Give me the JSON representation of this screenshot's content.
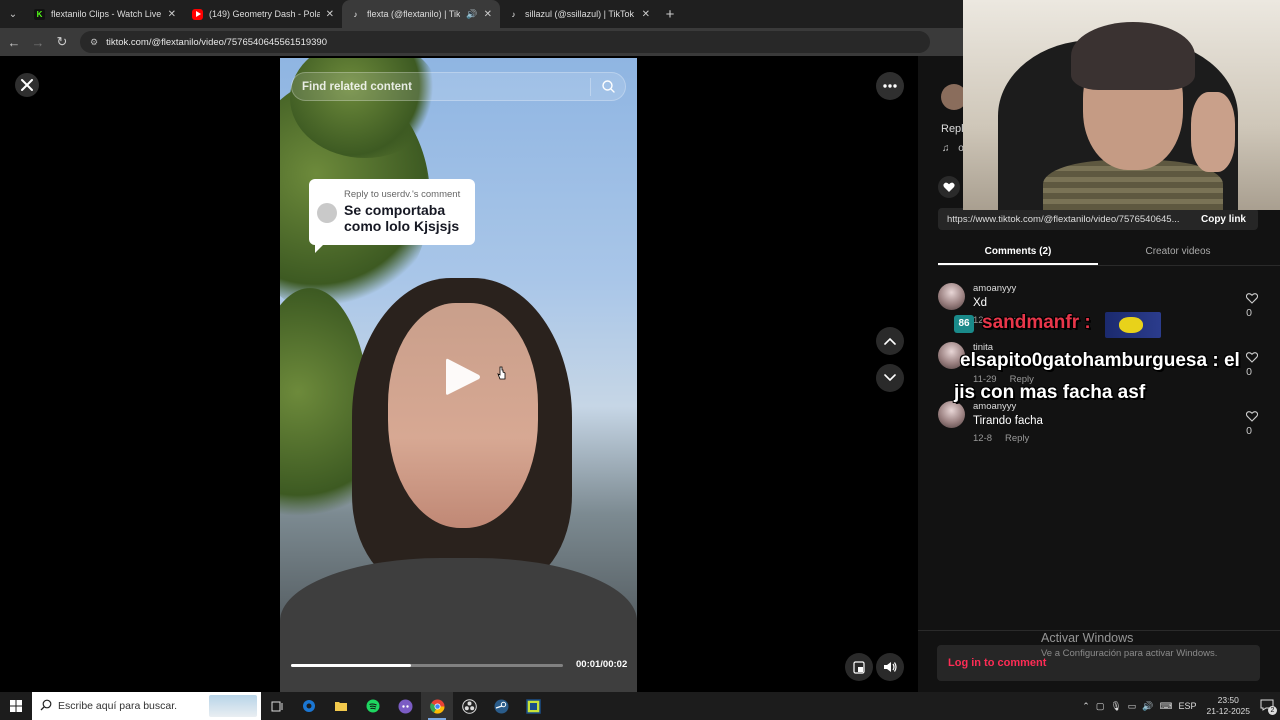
{
  "browser": {
    "tabs": [
      {
        "title": "flextanilo Clips - Watch Live on",
        "favicon": "kick-icon",
        "favicon_color": "#53fc18",
        "active": false
      },
      {
        "title": "(149) Geometry Dash - Polargeist",
        "favicon": "youtube-icon",
        "favicon_color": "#ff0000",
        "active": false
      },
      {
        "title": "flexta (@flextanilo) | TikTok",
        "favicon": "tiktok-icon",
        "favicon_color": "#ffffff",
        "active": true
      },
      {
        "title": "sillazul (@ssillazul) | TikTok",
        "favicon": "tiktok-icon",
        "favicon_color": "#ffffff",
        "active": false
      }
    ],
    "url": "tiktok.com/@flextanilo/video/7576540645561519390"
  },
  "video": {
    "search_placeholder": "Find related content",
    "reply_header": "Reply to userdv.'s comment",
    "reply_text": "Se comportaba como lolo Kjsjsjs",
    "timecode": "00:01/00:02",
    "progress": 0.44
  },
  "panel": {
    "truncated_reply": "Repl",
    "truncated_music": "o",
    "share_url": "https://www.tiktok.com/@flextanilo/video/757654064​5...",
    "copy_link": "Copy link",
    "tabs": [
      "Comments (2)",
      "Creator videos"
    ],
    "comments": [
      {
        "user": "amoanyyy",
        "text": "Xd",
        "date": "12-8",
        "reply": "Reply",
        "likes": "0"
      },
      {
        "user": "tinita",
        "text": "",
        "date": "11-29",
        "reply": "Reply",
        "likes": "0"
      },
      {
        "user": "amoanyyy",
        "text": "Tirando facha",
        "date": "12-8",
        "reply": "Reply",
        "likes": "0"
      }
    ],
    "login": "Log in to comment"
  },
  "watermark": {
    "line1": "Activar Windows",
    "line2": "Ve a Configuración para activar Windows."
  },
  "overlay_chat": {
    "badge": "86",
    "line1": "sandmanfr :",
    "line2": "elsapito0gatohamburguesa : el",
    "line3": "jis con mas facha asf",
    "line1_color": "#e8364a"
  },
  "taskbar": {
    "search_placeholder": "Escribe aquí para buscar.",
    "lang": "ESP",
    "time": "23:50",
    "date": "21-12-2025",
    "notif_count": "2"
  }
}
